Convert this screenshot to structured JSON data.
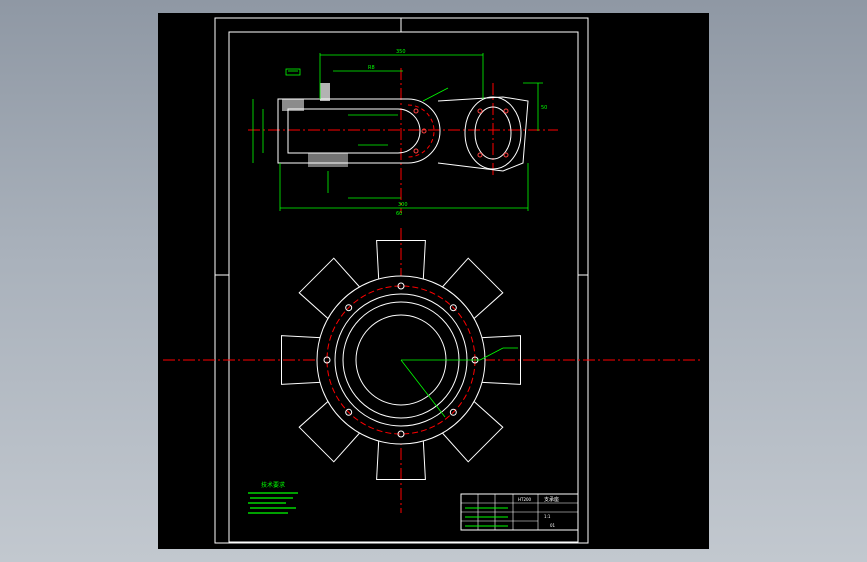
{
  "drawing": {
    "title_block": {
      "part_name": "支承座",
      "material": "HT200",
      "scale": "1:1",
      "drawing_no": "01"
    },
    "notes": {
      "heading": "技术要求"
    },
    "dimensions": {
      "overall_length": "350",
      "top_offset": "R8",
      "side_height": "50",
      "bottom_length": "300",
      "center_mark": "60"
    },
    "colors": {
      "background": "#000000",
      "outline": "#ffffff",
      "dimension": "#00ff00",
      "centerline": "#ff0000",
      "frame": "#ffffff"
    }
  }
}
